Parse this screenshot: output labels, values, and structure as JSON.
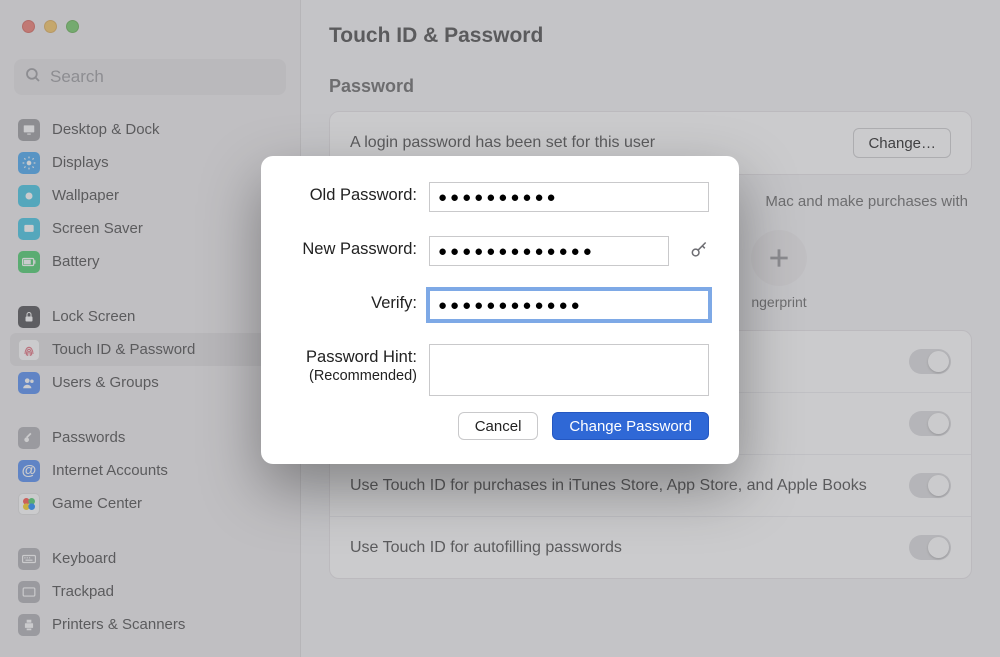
{
  "window": {
    "title": "Touch ID & Password"
  },
  "sidebar": {
    "search_placeholder": "Search",
    "groups": [
      [
        {
          "icon": "desktop",
          "bg": "#8e8e93",
          "label": "Desktop & Dock"
        },
        {
          "icon": "displays",
          "bg": "#2f9cef",
          "label": "Displays"
        },
        {
          "icon": "wallpaper",
          "bg": "#29bde0",
          "label": "Wallpaper"
        },
        {
          "icon": "screensaver",
          "bg": "#29bde0",
          "label": "Screen Saver"
        },
        {
          "icon": "battery",
          "bg": "#34c759",
          "label": "Battery"
        }
      ],
      [
        {
          "icon": "lock",
          "bg": "#3a3a3c",
          "label": "Lock Screen"
        },
        {
          "icon": "touchid",
          "bg": "#ffffff",
          "label": "Touch ID & Password",
          "selected": true
        },
        {
          "icon": "users",
          "bg": "#3d7ff0",
          "label": "Users & Groups"
        }
      ],
      [
        {
          "icon": "key",
          "bg": "#a7a7ab",
          "label": "Passwords"
        },
        {
          "icon": "at",
          "bg": "#3d7ff0",
          "label": "Internet Accounts"
        },
        {
          "icon": "game",
          "bg": "#ffffff",
          "label": "Game Center"
        }
      ],
      [
        {
          "icon": "keyboard",
          "bg": "#a7a7ab",
          "label": "Keyboard"
        },
        {
          "icon": "trackpad",
          "bg": "#a7a7ab",
          "label": "Trackpad"
        },
        {
          "icon": "printer",
          "bg": "#a7a7ab",
          "label": "Printers & Scanners"
        }
      ]
    ]
  },
  "main": {
    "section_password": "Password",
    "login_set_text": "A login password has been set for this user",
    "change_button": "Change…",
    "touchid_desc_partial": "Mac and make purchases with",
    "add_fingerprint": "ngerprint",
    "toggles": [
      {
        "text": ""
      },
      {
        "text": ""
      },
      {
        "text": "Use Touch ID for purchases in iTunes Store, App Store, and Apple Books"
      },
      {
        "text": "Use Touch ID for autofilling passwords"
      }
    ]
  },
  "modal": {
    "old_label": "Old Password:",
    "old_value": "●●●●●●●●●●",
    "new_label": "New Password:",
    "new_value": "●●●●●●●●●●●●●",
    "verify_label": "Verify:",
    "verify_value": "●●●●●●●●●●●●",
    "hint_label": "Password Hint:",
    "hint_sub": "(Recommended)",
    "hint_value": "",
    "cancel": "Cancel",
    "change": "Change Password"
  }
}
